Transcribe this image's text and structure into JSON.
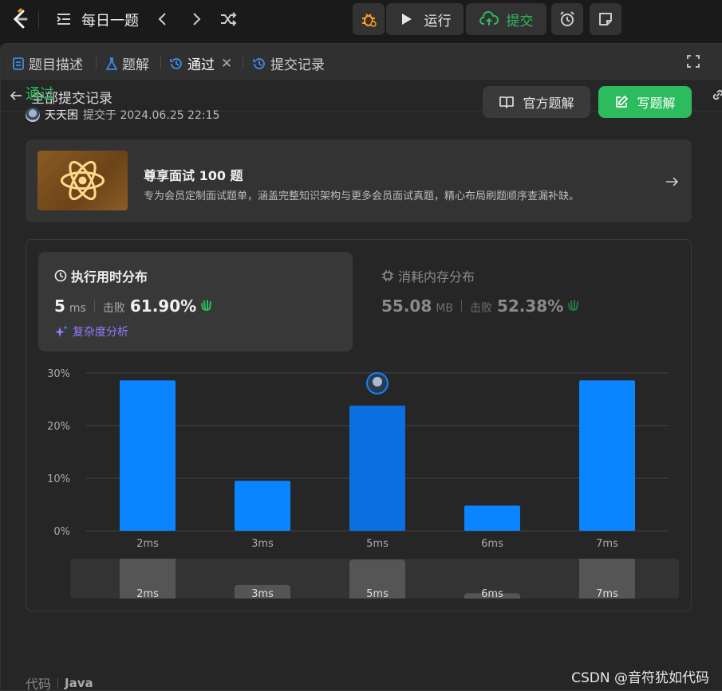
{
  "topbar": {
    "title": "每日一题",
    "run_label": "运行",
    "submit_label": "提交"
  },
  "tabs": [
    {
      "label": "题目描述"
    },
    {
      "label": "题解"
    },
    {
      "label": "通过"
    },
    {
      "label": "提交记录"
    }
  ],
  "tab_close": "✕",
  "subnav": {
    "back_label": "全部提交记录"
  },
  "submission": {
    "status": "通过",
    "user": "天天困",
    "submitted_text": "提交于 2024.06.25 22:15"
  },
  "actions": {
    "official_label": "官方题解",
    "write_label": "写题解"
  },
  "promo": {
    "title": "尊享面试 100 题",
    "desc": "专为会员定制面试题单，涵盖完整知识架构与更多会员面试真题，精心布局刷题顺序查漏补缺。"
  },
  "runtime": {
    "title": "执行用时分布",
    "value": "5",
    "unit": "ms",
    "beat_label": "击败",
    "percent": "61.90%",
    "complexity_label": "复杂度分析"
  },
  "memory": {
    "title": "消耗内存分布",
    "value": "55.08",
    "unit": "MB",
    "beat_label": "击败",
    "percent": "52.38%"
  },
  "chart_data": {
    "type": "bar",
    "categories": [
      "2ms",
      "3ms",
      "5ms",
      "6ms",
      "7ms"
    ],
    "values": [
      28.6,
      9.5,
      23.8,
      4.8,
      28.6
    ],
    "highlight": "5ms",
    "yticks": [
      "0%",
      "10%",
      "20%",
      "30%"
    ],
    "ylim": [
      0,
      30
    ],
    "grid": true,
    "colors": {
      "bar": "#0a84ff",
      "highlight": "#0a6fe0",
      "grid": "#444444"
    }
  },
  "minimap": {
    "labels": [
      "2ms",
      "3ms",
      "5ms",
      "6ms",
      "7ms"
    ]
  },
  "code": {
    "label": "代码",
    "language": "Java"
  },
  "watermark": "CSDN @音符犹如代码",
  "colors": {
    "accent_green": "#2cbb5d",
    "accent_blue": "#0a84ff",
    "purple": "#8f7cff"
  }
}
